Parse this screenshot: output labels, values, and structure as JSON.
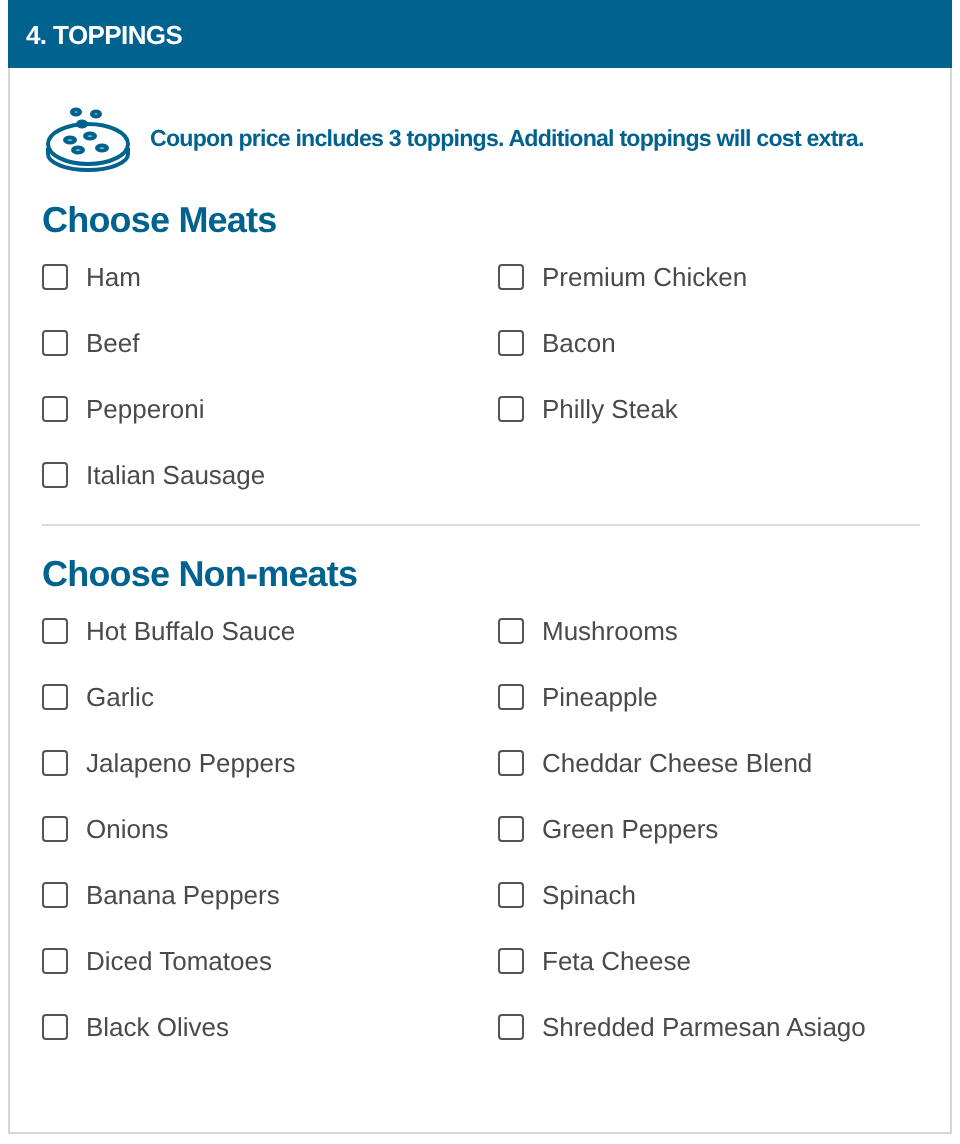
{
  "section": {
    "title": "4. TOPPINGS"
  },
  "notice": "Coupon price includes 3 toppings. Additional toppings will cost extra.",
  "groups": [
    {
      "title": "Choose Meats",
      "items": [
        {
          "label": "Ham",
          "checked": false
        },
        {
          "label": "Premium Chicken",
          "checked": false
        },
        {
          "label": "Beef",
          "checked": false
        },
        {
          "label": "Bacon",
          "checked": false
        },
        {
          "label": "Pepperoni",
          "checked": false
        },
        {
          "label": "Philly Steak",
          "checked": false
        },
        {
          "label": "Italian Sausage",
          "checked": false
        }
      ]
    },
    {
      "title": "Choose Non-meats",
      "items": [
        {
          "label": "Hot Buffalo Sauce",
          "checked": false
        },
        {
          "label": "Mushrooms",
          "checked": false
        },
        {
          "label": "Garlic",
          "checked": false
        },
        {
          "label": "Pineapple",
          "checked": false
        },
        {
          "label": "Jalapeno Peppers",
          "checked": false
        },
        {
          "label": "Cheddar Cheese Blend",
          "checked": false
        },
        {
          "label": "Onions",
          "checked": false
        },
        {
          "label": "Green Peppers",
          "checked": false
        },
        {
          "label": "Banana Peppers",
          "checked": false
        },
        {
          "label": "Spinach",
          "checked": false
        },
        {
          "label": "Diced Tomatoes",
          "checked": false
        },
        {
          "label": "Feta Cheese",
          "checked": false
        },
        {
          "label": "Black Olives",
          "checked": false
        },
        {
          "label": "Shredded Parmesan Asiago",
          "checked": false
        }
      ]
    }
  ]
}
